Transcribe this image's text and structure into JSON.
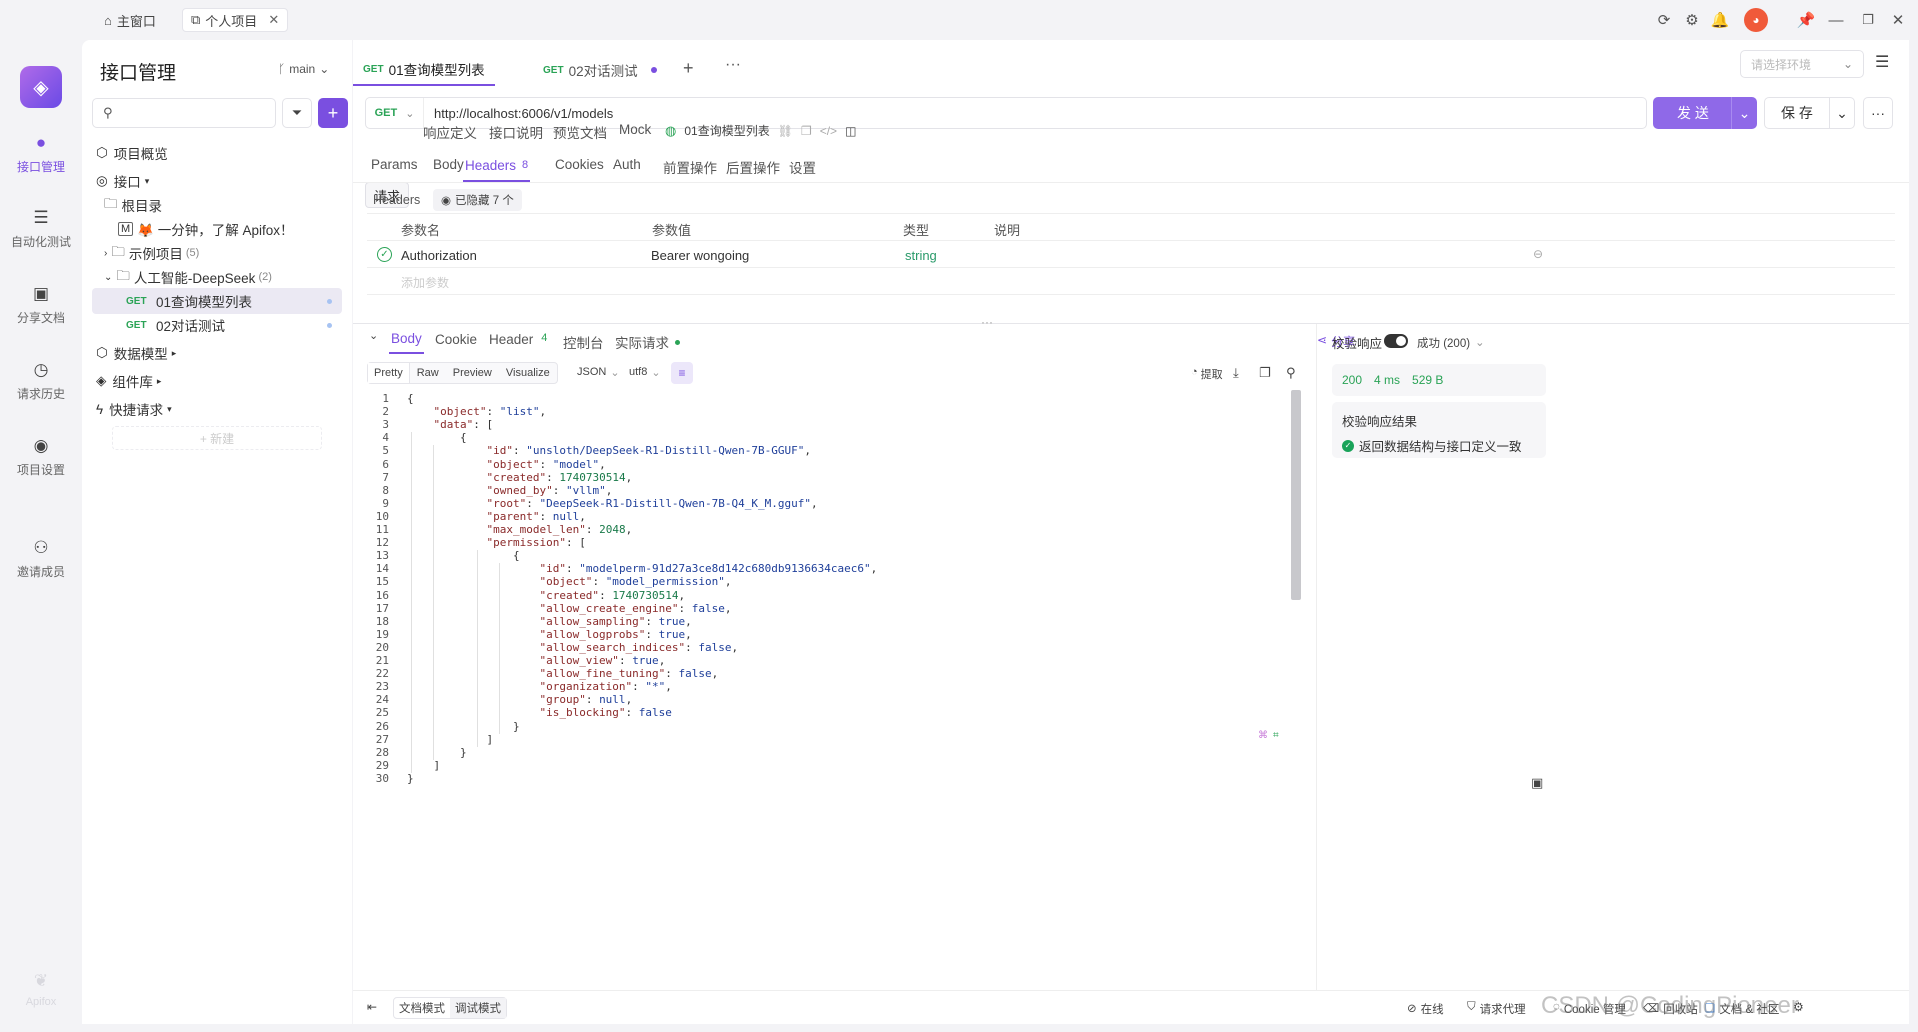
{
  "window": {
    "tabs": [
      {
        "label": "主窗口",
        "icon": "home-icon"
      },
      {
        "label": "个人项目",
        "icon": "link-icon"
      }
    ],
    "controls": [
      "refresh-icon",
      "gear-icon",
      "bell-icon",
      "avatar",
      "pin-icon",
      "minimize-icon",
      "restore-icon",
      "close-icon"
    ]
  },
  "leftnav": {
    "items": [
      {
        "label": "接口管理",
        "icon": "api-icon",
        "active": true
      },
      {
        "label": "自动化测试",
        "icon": "stack-icon"
      },
      {
        "label": "分享文档",
        "icon": "book-icon"
      },
      {
        "label": "请求历史",
        "icon": "clock-icon"
      },
      {
        "label": "项目设置",
        "icon": "settings-icon"
      },
      {
        "label": "邀请成员",
        "icon": "user-add-icon"
      }
    ],
    "brand": "Apifox"
  },
  "sidebar": {
    "title": "接口管理",
    "branch": "main",
    "tree": {
      "overview": "项目概览",
      "apis": "接口",
      "root": "根目录",
      "intro": "🦊 一分钟，了解 Apifox！",
      "folder1": "示例项目",
      "folder1_count": "(5)",
      "folder2": "人工智能-DeepSeek",
      "folder2_count": "(2)",
      "ep1_method": "GET",
      "ep1_name": "01查询模型列表",
      "ep2_method": "GET",
      "ep2_name": "02对话测试",
      "models": "数据模型",
      "components": "组件库",
      "quick": "快捷请求",
      "new": "+ 新建"
    }
  },
  "main": {
    "tabs": [
      {
        "method": "GET",
        "name": "01查询模型列表"
      },
      {
        "method": "GET",
        "name": "02对话测试"
      }
    ],
    "env_placeholder": "请选择环境",
    "method": "GET",
    "url": "http://localhost:6006/v1/models",
    "send": "发 送",
    "save": "保 存",
    "mode_tabs": [
      "请求",
      "响应定义",
      "接口说明",
      "预览文档",
      "Mock"
    ],
    "endpoint_name": "01查询模型列表",
    "req_tabs": [
      "Params",
      "Body",
      "Headers",
      "Cookies",
      "Auth",
      "前置操作",
      "后置操作",
      "设置"
    ],
    "headers_count": "8",
    "headers_label": "Headers",
    "hidden": "已隐藏 7 个",
    "cols": [
      "参数名",
      "参数值",
      "类型",
      "说明"
    ],
    "row": {
      "name": "Authorization",
      "value": "Bearer wongoing",
      "type": "string"
    },
    "add_param": "添加参数",
    "resp_tabs": [
      "Body",
      "Cookie",
      "Header",
      "控制台",
      "实际请求"
    ],
    "resp_header_count": "4",
    "share": "分享",
    "view_tabs": [
      "Pretty",
      "Raw",
      "Preview",
      "Visualize"
    ],
    "format": "JSON",
    "encoding": "utf8",
    "extract": "提取",
    "code": [
      "{",
      "    \"object\": \"list\",",
      "    \"data\": [",
      "        {",
      "            \"id\": \"unsloth/DeepSeek-R1-Distill-Qwen-7B-GGUF\",",
      "            \"object\": \"model\",",
      "            \"created\": 1740730514,",
      "            \"owned_by\": \"vllm\",",
      "            \"root\": \"DeepSeek-R1-Distill-Qwen-7B-Q4_K_M.gguf\",",
      "            \"parent\": null,",
      "            \"max_model_len\": 2048,",
      "            \"permission\": [",
      "                {",
      "                    \"id\": \"modelperm-91d27a3ce8d142c680db9136634caec6\",",
      "                    \"object\": \"model_permission\",",
      "                    \"created\": 1740730514,",
      "                    \"allow_create_engine\": false,",
      "                    \"allow_sampling\": true,",
      "                    \"allow_logprobs\": true,",
      "                    \"allow_search_indices\": false,",
      "                    \"allow_view\": true,",
      "                    \"allow_fine_tuning\": false,",
      "                    \"organization\": \"*\",",
      "                    \"group\": null,",
      "                    \"is_blocking\": false",
      "                }",
      "            ]",
      "        }",
      "    ]",
      "}"
    ],
    "validate_label": "校验响应",
    "status_select": "成功 (200)",
    "status_code": "200",
    "time": "4 ms",
    "size": "529 B",
    "result_title": "校验响应结果",
    "result_msg": "返回数据结构与接口定义一致"
  },
  "bottom": {
    "doc_mode": "文档模式",
    "debug_mode": "调试模式",
    "online": "在线",
    "proxy": "请求代理",
    "cookie": "Cookie 管理",
    "recycle": "回收站",
    "docs": "文档 & 社区",
    "watermark": "CSDN @CodingPioneer"
  },
  "colors": {
    "accent": "#7a4fe0",
    "get": "#2aa356",
    "ok": "#1aa35a"
  }
}
